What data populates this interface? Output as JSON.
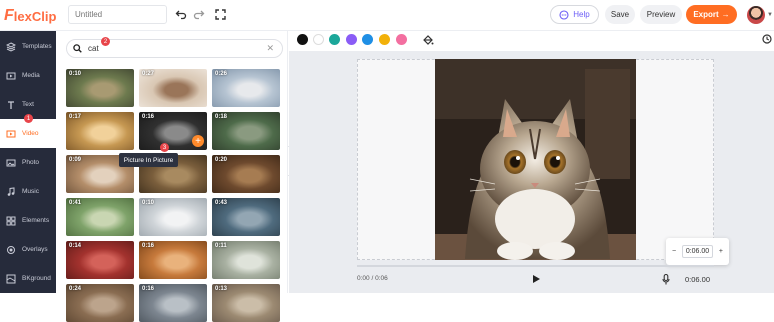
{
  "header": {
    "logo": "FlexClip",
    "title_placeholder": "Untitled",
    "help_label": "Help",
    "save_label": "Save",
    "preview_label": "Preview",
    "export_label": "Export"
  },
  "sidebar": {
    "items": [
      {
        "label": "Templates",
        "icon": "layers-icon"
      },
      {
        "label": "Media",
        "icon": "media-icon"
      },
      {
        "label": "Text",
        "icon": "text-icon"
      },
      {
        "label": "Video",
        "icon": "video-icon",
        "active": true
      },
      {
        "label": "Photo",
        "icon": "photo-icon"
      },
      {
        "label": "Music",
        "icon": "music-icon"
      },
      {
        "label": "Elements",
        "icon": "elements-icon"
      },
      {
        "label": "Overlays",
        "icon": "overlays-icon"
      },
      {
        "label": "BKground",
        "icon": "background-icon"
      }
    ],
    "badge": "1"
  },
  "panel": {
    "search_value": "cat",
    "search_badge": "2",
    "tooltip": "Picture In Picture",
    "tooltip_badge": "3",
    "videos": [
      {
        "duration": "0:10",
        "colors": [
          "#6d7a4e",
          "#a89a72",
          "#3e4330"
        ]
      },
      {
        "duration": "0:27",
        "colors": [
          "#d9c7b3",
          "#9a7559",
          "#efe7de"
        ]
      },
      {
        "duration": "0:26",
        "colors": [
          "#b6c4d2",
          "#e7e9ec",
          "#7f93a8"
        ]
      },
      {
        "duration": "0:17",
        "colors": [
          "#c69852",
          "#f1d19a",
          "#7a5426"
        ]
      },
      {
        "duration": "0:16",
        "colors": [
          "#303030",
          "#8a8a8a",
          "#1a1a1a"
        ]
      },
      {
        "duration": "0:18",
        "colors": [
          "#4e6b4a",
          "#8a9a80",
          "#2d3a2a"
        ]
      },
      {
        "duration": "0:09",
        "colors": [
          "#b48e6a",
          "#e3d1bd",
          "#6b5038"
        ]
      },
      {
        "duration": "",
        "colors": [
          "#7a5e3c",
          "#a88a60",
          "#3d2e1c"
        ]
      },
      {
        "duration": "0:20",
        "colors": [
          "#6e4a2e",
          "#a67c52",
          "#3b2616"
        ]
      },
      {
        "duration": "0:41",
        "colors": [
          "#7fa36a",
          "#c9d6b2",
          "#4d6b3d"
        ]
      },
      {
        "duration": "0:10",
        "colors": [
          "#cfd4d8",
          "#f2f3f4",
          "#9aa3aa"
        ]
      },
      {
        "duration": "0:43",
        "colors": [
          "#4f6b7e",
          "#93a6b3",
          "#2a3b47"
        ]
      },
      {
        "duration": "0:14",
        "colors": [
          "#a3322e",
          "#d4625a",
          "#5e1b18"
        ]
      },
      {
        "duration": "0:16",
        "colors": [
          "#c77a3c",
          "#e9b27c",
          "#7a4318"
        ]
      },
      {
        "duration": "0:11",
        "colors": [
          "#a9b1a2",
          "#dfe3da",
          "#6e7768"
        ]
      },
      {
        "duration": "0:24",
        "colors": [
          "#8a6d52",
          "#bca48c",
          "#5a4430"
        ]
      },
      {
        "duration": "0:16",
        "colors": [
          "#7d8690",
          "#b9c0c6",
          "#4b535b"
        ]
      },
      {
        "duration": "0:13",
        "colors": [
          "#9c8a72",
          "#cbbda8",
          "#66574a"
        ]
      }
    ]
  },
  "editor": {
    "colors": [
      "#111111",
      "#ffffff",
      "#1ba79a",
      "#8a5cf6",
      "#1f8fe5",
      "#f2b10a",
      "#f36fa0"
    ],
    "time_label": "0:00 / 0:06",
    "duration_total": "0:06.00",
    "stepper_value": "0:06.00",
    "stepper_minus": "−",
    "stepper_plus": "+"
  }
}
